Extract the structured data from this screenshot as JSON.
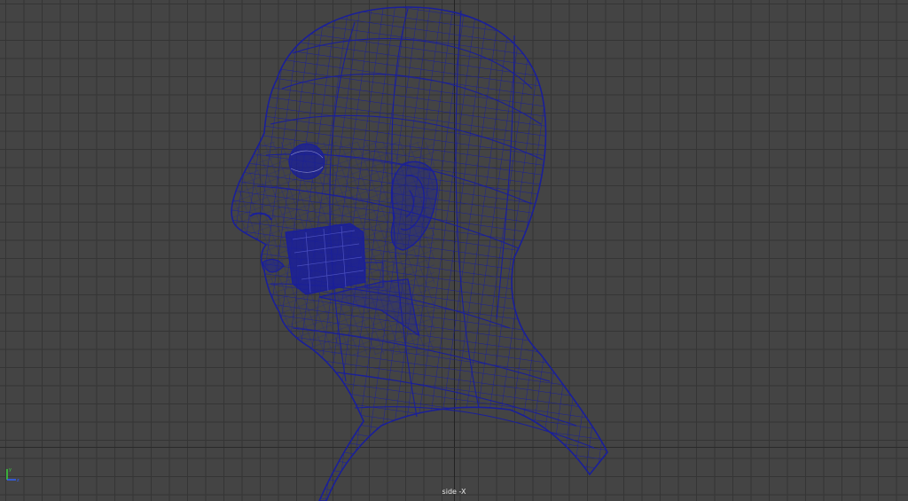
{
  "viewport": {
    "camera_label": "side -X",
    "mesh_color": "#1a1f9a",
    "grid_color": "#353535",
    "background_color": "#444444"
  },
  "gizmo": {
    "up_axis": "y",
    "up_color": "#39d039",
    "right_axis": "z",
    "right_color": "#3060ff"
  }
}
